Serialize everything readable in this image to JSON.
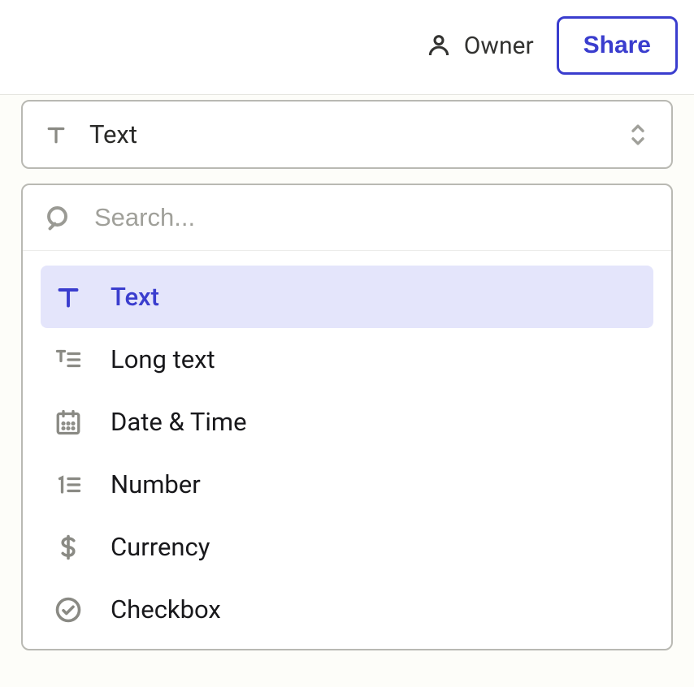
{
  "header": {
    "owner_label": "Owner",
    "share_label": "Share"
  },
  "selector": {
    "selected_label": "Text",
    "search_placeholder": "Search...",
    "options": [
      {
        "id": "text",
        "label": "Text",
        "icon": "text-icon",
        "selected": true
      },
      {
        "id": "long_text",
        "label": "Long text",
        "icon": "long-text-icon",
        "selected": false
      },
      {
        "id": "datetime",
        "label": "Date & Time",
        "icon": "datetime-icon",
        "selected": false
      },
      {
        "id": "number",
        "label": "Number",
        "icon": "number-icon",
        "selected": false
      },
      {
        "id": "currency",
        "label": "Currency",
        "icon": "currency-icon",
        "selected": false
      },
      {
        "id": "checkbox",
        "label": "Checkbox",
        "icon": "checkbox-icon",
        "selected": false
      }
    ]
  }
}
